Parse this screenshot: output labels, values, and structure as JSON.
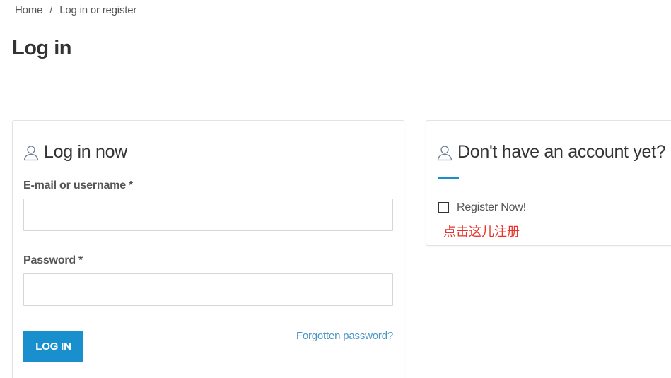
{
  "breadcrumb": {
    "home": "Home",
    "separator": "/",
    "current": "Log in or register"
  },
  "page_title": "Log in",
  "login_card": {
    "heading": "Log in now",
    "icon": "user-icon",
    "username_label": "E-mail or username",
    "password_label": "Password",
    "required_marker": "*",
    "username_value": "",
    "password_value": "",
    "submit_label": "LOG IN",
    "forgot_label": "Forgotten password?"
  },
  "register_card": {
    "heading": "Don't have an account yet?",
    "icon": "user-icon",
    "register_label": "Register Now!",
    "register_checked": false,
    "hint": "点击这儿注册"
  },
  "colors": {
    "accent": "#1a8fce",
    "link": "#4a96c6",
    "hint_red": "#e8342c"
  }
}
